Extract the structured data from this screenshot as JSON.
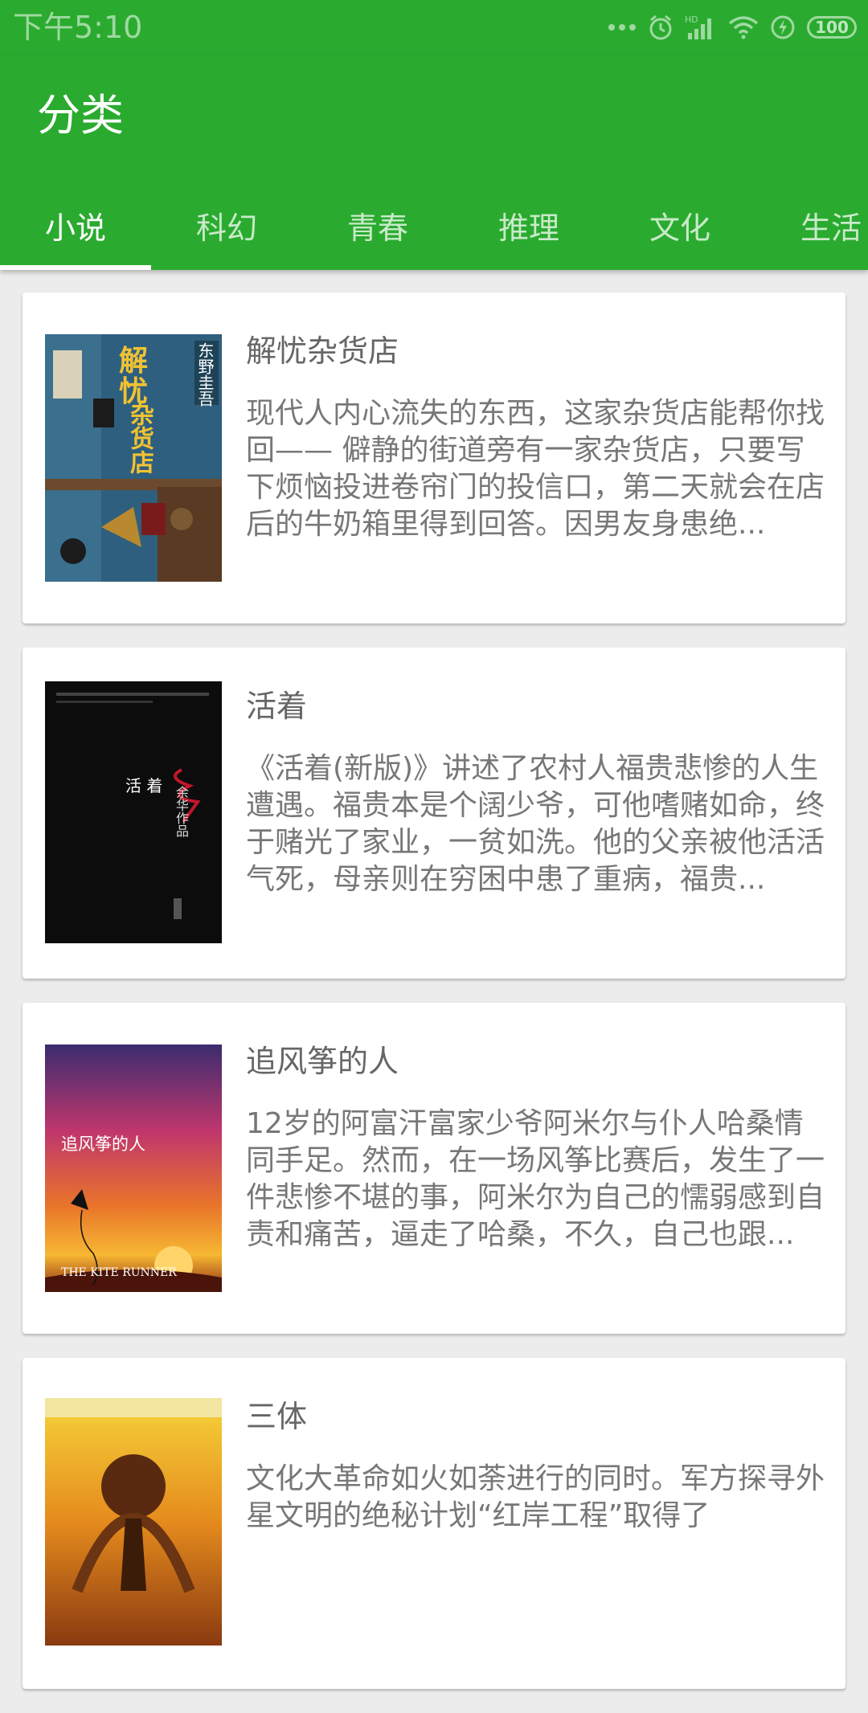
{
  "status_bar": {
    "time": "下午5:10",
    "battery": "100"
  },
  "header": {
    "title": "分类"
  },
  "tabs": [
    {
      "label": "小说"
    },
    {
      "label": "科幻"
    },
    {
      "label": "青春"
    },
    {
      "label": "推理"
    },
    {
      "label": "文化"
    },
    {
      "label": "生活"
    }
  ],
  "books": [
    {
      "title": "解忧杂货店",
      "description": "现代人内心流失的东西，这家杂货店能帮你找回—— 僻静的街道旁有一家杂货店，只要写下烦恼投进卷帘门的投信口，第二天就会在店后的牛奶箱里得到回答。因男友身患绝...",
      "cover_text": {
        "title": "解忧\n杂货店",
        "author": "东野圭吾"
      }
    },
    {
      "title": "活着",
      "description": "《活着(新版)》讲述了农村人福贵悲惨的人生遭遇。福贵本是个阔少爷，可他嗜赌如命，终于赌光了家业，一贫如洗。他的父亲被他活活气死，母亲则在穷困中患了重病，福贵...",
      "cover_text": {
        "title": "活 着",
        "author": "余华作品"
      }
    },
    {
      "title": "追风筝的人",
      "description": "12岁的阿富汗富家少爷阿米尔与仆人哈桑情同手足。然而，在一场风筝比赛后，发生了一件悲惨不堪的事，阿米尔为自己的懦弱感到自责和痛苦，逼走了哈桑，不久，自己也跟...",
      "cover_text": {
        "title": "追风筝的人",
        "english": "THE KITE RUNNER"
      }
    },
    {
      "title": "三体",
      "description": "文化大革命如火如荼进行的同时。军方探寻外星文明的绝秘计划“红岸工程”取得了",
      "cover_text": {}
    }
  ]
}
